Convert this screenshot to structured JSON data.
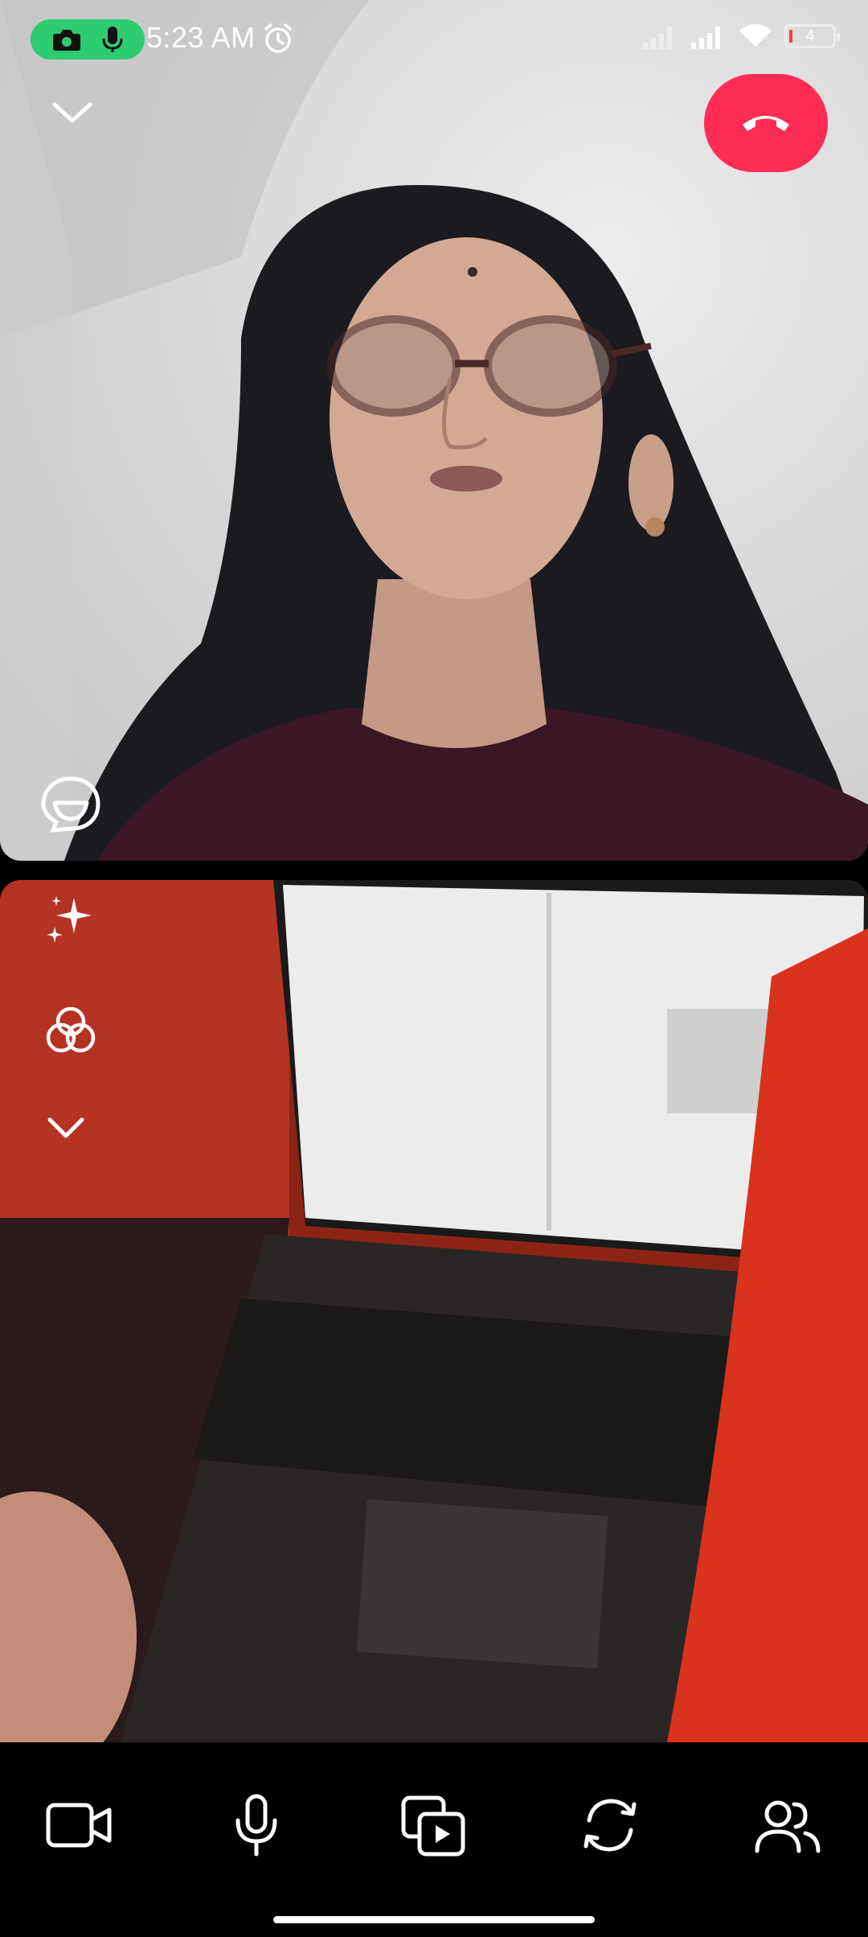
{
  "status_bar": {
    "time": "5:23 AM",
    "battery_level": "4",
    "icons": [
      "camera-in-use-icon",
      "mic-in-use-icon",
      "alarm-icon",
      "signal-icon",
      "signal-icon",
      "wifi-icon",
      "battery-icon"
    ]
  },
  "call": {
    "controls_top": [
      "collapse-icon",
      "end-call-icon"
    ],
    "effects_side": [
      "sparkle-effects-icon",
      "filters-icon",
      "more-chevron-icon"
    ],
    "bottom_bar": [
      "camera-toggle-icon",
      "microphone-icon",
      "media-share-icon",
      "flip-camera-icon",
      "participants-icon"
    ],
    "colors": {
      "end_call": "#ff2d55",
      "recording_indicator": "#2ecc71"
    }
  }
}
